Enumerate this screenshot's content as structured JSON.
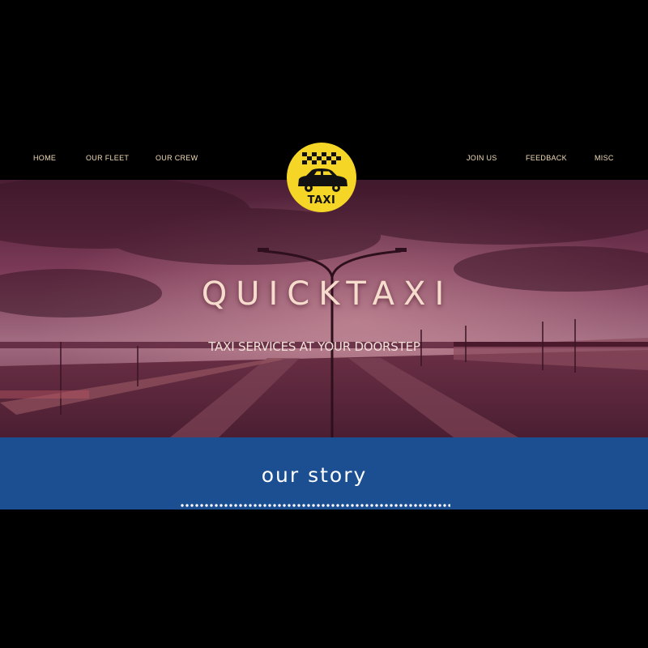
{
  "nav": {
    "left": [
      "HOME",
      "OUR FLEET",
      "OUR CREW"
    ],
    "right": [
      "JOIN US",
      "FEEDBACK",
      "MISC"
    ]
  },
  "logo": {
    "text": "TAXI",
    "icon": "taxi-car-icon"
  },
  "hero": {
    "title": "QUICKTAXI",
    "subtitle": "TAXI SERVICES AT YOUR DOORSTEP",
    "image": "highway-at-dusk-photo"
  },
  "story": {
    "heading": "our story"
  },
  "colors": {
    "background": "#000000",
    "nav_text": "#f3dcb8",
    "logo_yellow": "#f5d627",
    "hero_tint": "#7a2e4a",
    "story_blue": "#1b4f91"
  }
}
